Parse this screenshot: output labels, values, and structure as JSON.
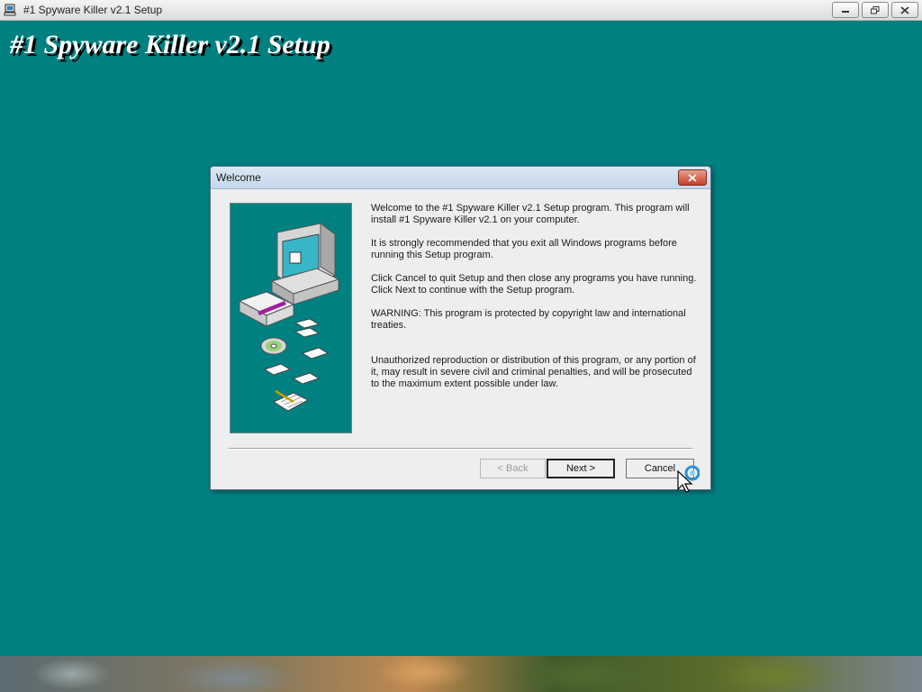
{
  "window": {
    "title": "#1 Spyware Killer v2.1 Setup",
    "controls": [
      "minimize-icon",
      "restore-icon",
      "close-icon"
    ]
  },
  "setup": {
    "heading": "#1 Spyware Killer v2.1 Setup",
    "background_color": "#008080"
  },
  "dialog": {
    "title": "Welcome",
    "paragraphs": [
      "Welcome to the #1 Spyware Killer v2.1 Setup program. This program will install #1 Spyware Killer v2.1 on your computer.",
      "It is strongly recommended that you exit all Windows programs before running this Setup program.",
      "Click Cancel to quit Setup and then close any programs you have running. Click Next to continue with the Setup program.",
      "WARNING: This program is protected by copyright law and international treaties.",
      "Unauthorized reproduction or distribution of this program, or any portion of it, may result in severe civil and criminal penalties, and will be prosecuted to the maximum extent possible under law."
    ],
    "buttons": {
      "back": "< Back",
      "next": "Next >",
      "cancel": "Cancel"
    },
    "back_enabled": false
  },
  "icons": {
    "app": "setup-app-icon",
    "dialog_close": "close-icon",
    "illustration": "computer-disks-illustration",
    "cursor": "busy-arrow-cursor-icon"
  }
}
